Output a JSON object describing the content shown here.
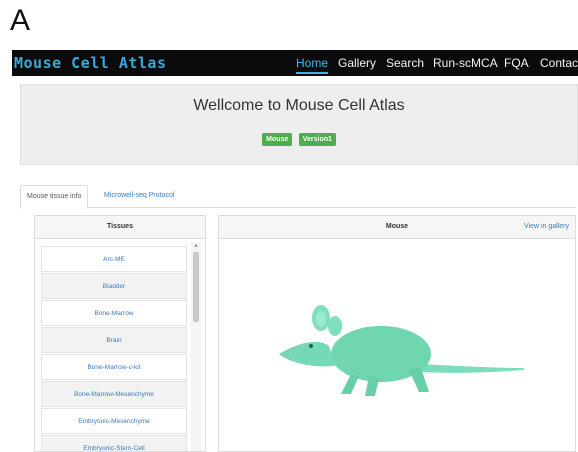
{
  "panel_label": "A",
  "navbar": {
    "brand": "Mouse Cell Atlas",
    "items": [
      "Home",
      "Gallery",
      "Search",
      "Run-scMCA",
      "FQA",
      "Contact"
    ],
    "active": "Home",
    "accent_color": "#43b4ea"
  },
  "welcome": {
    "title": "Wellcome to Mouse Cell Atlas",
    "badges": [
      "Mouse",
      "Version1"
    ],
    "badge_color": "#4cae4c"
  },
  "tabs": [
    {
      "label": "Mouse tissue info",
      "active": true
    },
    {
      "label": "Microwell-seq Protocol",
      "active": false
    }
  ],
  "tissues": {
    "header": "Tissues",
    "items": [
      "Arc-ME",
      "Bladder",
      "Bone-Marrow",
      "Brain",
      "Bone-Marrow-c-kit",
      "Bone-Marrow-Mesenchyme",
      "Embryonic-Mesenchyme",
      "Embryonic-Stem-Cell"
    ]
  },
  "mouse_panel": {
    "title": "Mouse",
    "view_link": "View in gallery",
    "image": "mouse-3d-model",
    "mouse_color": "#6fd6b0"
  }
}
